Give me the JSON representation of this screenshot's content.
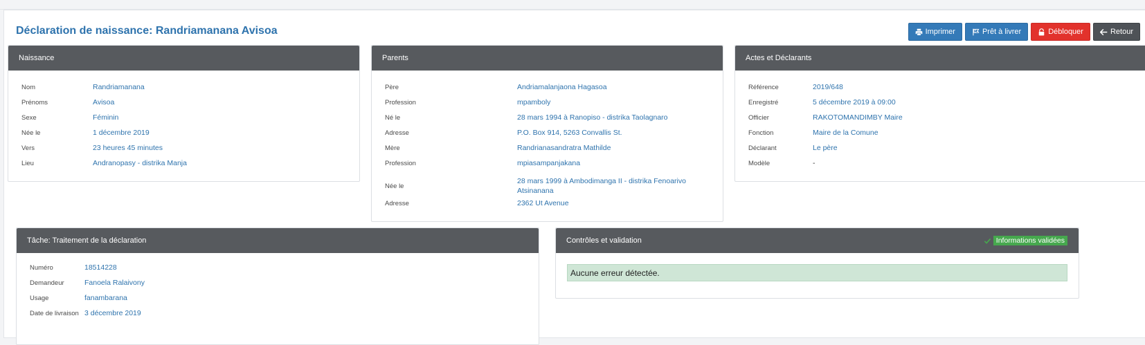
{
  "page": {
    "title": "Déclaration de naissance: Randriamanana Avisoa"
  },
  "actions": {
    "print": "Imprimer",
    "ready": "Prêt à livrer",
    "unlock": "Débloquer",
    "back": "Retour"
  },
  "naissance": {
    "title": "Naissance",
    "rows": [
      {
        "label": "Nom",
        "value": "Randriamanana"
      },
      {
        "label": "Prénoms",
        "value": "Avisoa"
      },
      {
        "label": "Sexe",
        "value": "Féminin"
      },
      {
        "label": "Née le",
        "value": "1 décembre 2019"
      },
      {
        "label": "Vers",
        "value": "23 heures 45 minutes"
      },
      {
        "label": "Lieu",
        "value": "Andranopasy - distrika Manja"
      }
    ]
  },
  "parents": {
    "title": "Parents",
    "rows": [
      {
        "label": "Père",
        "value": "Andriamalanjaona Hagasoa"
      },
      {
        "label": "Profession",
        "value": "mpamboly"
      },
      {
        "label": "Né le",
        "value": "28 mars 1994 à Ranopiso - distrika Taolagnaro"
      },
      {
        "label": "Adresse",
        "value": "P.O. Box 914, 5263 Convallis St."
      },
      {
        "label": "Mère",
        "value": "Randrianasandratra Mathilde"
      },
      {
        "label": "Profession",
        "value": "mpiasampanjakana"
      },
      {
        "label": "Née le",
        "value": "28 mars 1999 à Ambodimanga II - distrika Fenoarivo Atsinanana"
      },
      {
        "label": "Adresse",
        "value": "2362 Ut Avenue"
      }
    ]
  },
  "actes": {
    "title": "Actes et Déclarants",
    "rows": [
      {
        "label": "Référence",
        "value": "2019/648"
      },
      {
        "label": "Enregistré",
        "value": "5 décembre 2019 à 09:00"
      },
      {
        "label": "Officier",
        "value": "RAKOTOMANDIMBY Maire"
      },
      {
        "label": "Fonction",
        "value": "Maire de la Comune"
      },
      {
        "label": "Déclarant",
        "value": "Le père"
      },
      {
        "label": "Modèle",
        "value": "-"
      }
    ]
  },
  "tache": {
    "title": "Tâche: Traitement de la déclaration",
    "rows": [
      {
        "label": "Numéro",
        "value": "18514228"
      },
      {
        "label": "Demandeur",
        "value": "Fanoela Ralaivony"
      },
      {
        "label": "Usage",
        "value": "fanambarana"
      },
      {
        "label": "Date de livraison",
        "value": "3 décembre 2019"
      }
    ]
  },
  "controles": {
    "title": "Contrôles et validation",
    "badge": "Informations validées",
    "message": "Aucune erreur détectée."
  },
  "colors": {
    "primary": "#347ab8",
    "danger": "#e2322c",
    "dark": "#4e5257",
    "link": "#2e73ad",
    "success": "#46a84e",
    "panel_header": "#575a5e"
  }
}
